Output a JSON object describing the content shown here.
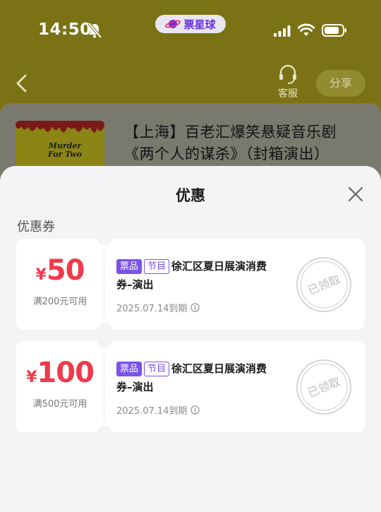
{
  "status_bar": {
    "time": "14:50",
    "app_name": "票星球"
  },
  "nav": {
    "service_label": "客服",
    "share_label": "分享"
  },
  "detail": {
    "title": "【上海】百老汇爆笑悬疑音乐剧《两个人的谋杀》（封箱演出）",
    "poster_title": "Murder For Two"
  },
  "sheet": {
    "title": "优惠",
    "section_label": "优惠券",
    "stamp_text": "已领取",
    "coupons": [
      {
        "currency": "¥",
        "amount": "50",
        "condition": "满200元可用",
        "tag_ticket": "票品",
        "tag_program": "节目",
        "name_line1": "徐汇区夏日展演消费",
        "name_line2": "券–演出",
        "expiry": "2025.07.14到期"
      },
      {
        "currency": "¥",
        "amount": "100",
        "condition": "满500元可用",
        "tag_ticket": "票品",
        "tag_program": "节目",
        "name_line1": "徐汇区夏日展演消费",
        "name_line2": "券–演出",
        "expiry": "2025.07.14到期"
      }
    ]
  },
  "colors": {
    "header_bg": "#7a7214",
    "price_red": "#ef3a4c",
    "tag_purple": "#7b52e8",
    "brand_purple": "#6d2fdc"
  }
}
